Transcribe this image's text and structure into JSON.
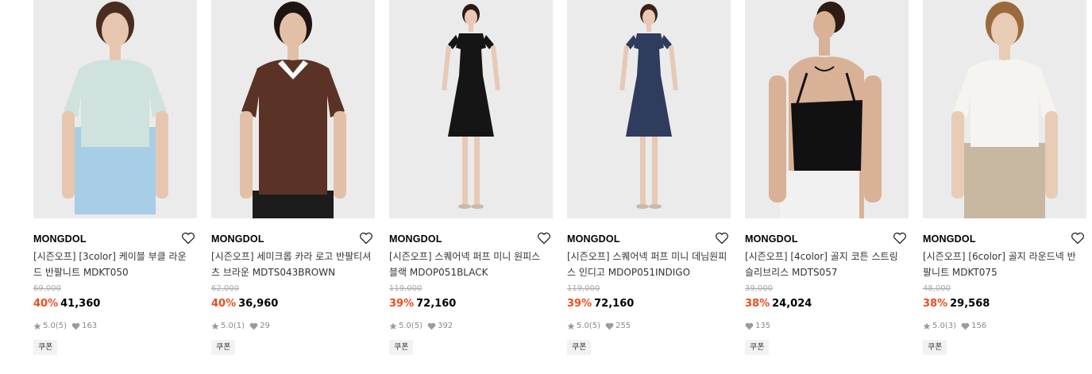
{
  "colors": {
    "discount": "#ef4b1b",
    "muted": "#8a8a8a",
    "coupon_bg": "#f2f2f2"
  },
  "products": [
    {
      "brand": "MONGDOL",
      "name": "[시즌오프] [3color] 케이블 부클 라운드 반팔니트 MDKT050",
      "original_price": "69,000",
      "discount": "40%",
      "price": "41,360",
      "rating": "5.0",
      "review_count": "(5)",
      "likes": "163",
      "coupon": "쿠폰",
      "image_desc": "model in mint cable knit top and light blue denim shorts",
      "top_color": "#cfe2de",
      "bottom_color": "#a8cde6"
    },
    {
      "brand": "MONGDOL",
      "name": "[시즌오프] 세미크롭 카라 로고 반팔티셔츠 브라운 MDTS043BROWN",
      "original_price": "62,000",
      "discount": "40%",
      "price": "36,960",
      "rating": "5.0",
      "review_count": "(1)",
      "likes": "29",
      "coupon": "쿠폰",
      "image_desc": "model in brown polo shirt with white collar",
      "top_color": "#5b3326",
      "bottom_color": "#1c1c1c"
    },
    {
      "brand": "MONGDOL",
      "name": "[시즌오프] 스퀘어넥 퍼프 미니 원피스 블랙 MDOP051BLACK",
      "original_price": "119,000",
      "discount": "39%",
      "price": "72,160",
      "rating": "5.0",
      "review_count": "(5)",
      "likes": "392",
      "coupon": "쿠폰",
      "image_desc": "model in black square neck mini dress",
      "top_color": "#151515",
      "bottom_color": "#151515"
    },
    {
      "brand": "MONGDOL",
      "name": "[시즌오프] 스퀘어넥 퍼프 미니 데님원피스 인디고 MDOP051INDIGO",
      "original_price": "119,000",
      "discount": "39%",
      "price": "72,160",
      "rating": "5.0",
      "review_count": "(5)",
      "likes": "255",
      "coupon": "쿠폰",
      "image_desc": "model in indigo denim square neck mini dress",
      "top_color": "#2f3c5e",
      "bottom_color": "#2f3c5e"
    },
    {
      "brand": "MONGDOL",
      "name": "[시즌오프] [4color] 골지 코튼 스트링 슬리브리스 MDTS057",
      "original_price": "39,000",
      "discount": "38%",
      "price": "24,024",
      "rating": "",
      "review_count": "",
      "likes": "135",
      "coupon": "쿠폰",
      "image_desc": "model in black string sleeveless top and white pants",
      "top_color": "#111111",
      "bottom_color": "#f1f1f1"
    },
    {
      "brand": "MONGDOL",
      "name": "[시즌오프] [6color] 골지 라운드넥 반팔니트 MDKT075",
      "original_price": "48,000",
      "discount": "38%",
      "price": "29,568",
      "rating": "5.0",
      "review_count": "(3)",
      "likes": "156",
      "coupon": "쿠폰",
      "image_desc": "model in white round neck knit and beige trousers",
      "top_color": "#f6f4f0",
      "bottom_color": "#c8b8a2"
    }
  ]
}
